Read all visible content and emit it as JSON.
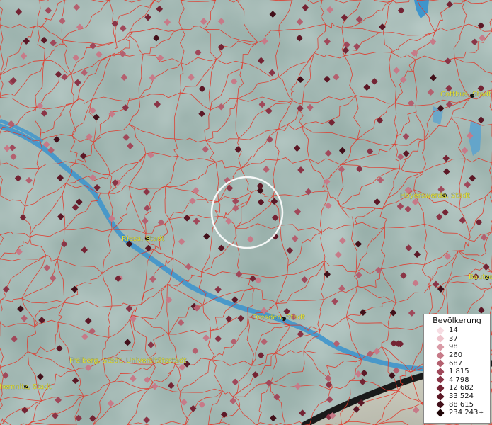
{
  "legend": {
    "title": "Bevölkerung",
    "items": [
      {
        "label": "14",
        "color": "#f7dde3"
      },
      {
        "label": "37",
        "color": "#eec4cc"
      },
      {
        "label": "98",
        "color": "#d99aa6"
      },
      {
        "label": "260",
        "color": "#c77a88"
      },
      {
        "label": "687",
        "color": "#b4606f"
      },
      {
        "label": "1 815",
        "color": "#a0485a"
      },
      {
        "label": "4 798",
        "color": "#8a3446"
      },
      {
        "label": "12 682",
        "color": "#742434"
      },
      {
        "label": "33 524",
        "color": "#5c1826"
      },
      {
        "label": "88 615",
        "color": "#42101a"
      },
      {
        "label": "234 243",
        "color": "#200608",
        "suffix": "+"
      }
    ]
  },
  "cities": [
    {
      "name": "Cottbus, Stadt"
    },
    {
      "name": "Hoyerswerda, Stadt"
    },
    {
      "name": "Riesa, Stadt"
    },
    {
      "name": "Dresden, Stadt"
    },
    {
      "name": "Freiberg, Stadt, Universitätsstadt"
    },
    {
      "name": "Chemnitz, Stadt"
    },
    {
      "name": "Bautzen"
    }
  ],
  "colors": {
    "terrain": "#8fa9a3",
    "water": "#3f95cc",
    "borders": "#e0392b",
    "label": "#e8e23a",
    "highlight_ring": "#ffffff"
  }
}
